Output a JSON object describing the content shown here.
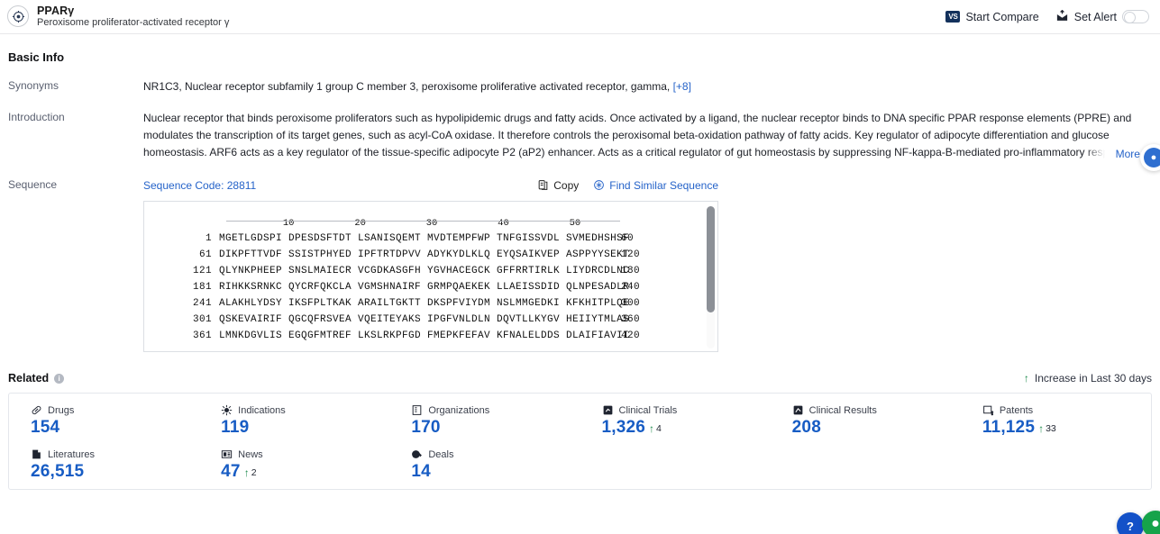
{
  "header": {
    "title": "PPARγ",
    "subtitle": "Peroxisome proliferator-activated receptor γ",
    "logo_icon": "target-crosshair-icon",
    "compare": {
      "badge": "VS",
      "label": "Start Compare"
    },
    "alert": {
      "icon": "alert-bell-icon",
      "label": "Set Alert",
      "toggle_on": false
    }
  },
  "basic_info": {
    "section_title": "Basic Info",
    "synonyms": {
      "label": "Synonyms",
      "value": "NR1C3,  Nuclear receptor subfamily 1 group C member 3,  peroxisome proliferative activated receptor, gamma,",
      "more_count": "[+8]"
    },
    "introduction": {
      "label": "Introduction",
      "text": "Nuclear receptor that binds peroxisome proliferators such as hypolipidemic drugs and fatty acids. Once activated by a ligand, the nuclear receptor binds to DNA specific PPAR response elements (PPRE) and modulates the transcription of its target genes, such as acyl-CoA oxidase. It therefore controls the peroxisomal beta-oxidation pathway of fatty acids. Key regulator of adipocyte differentiation and glucose homeostasis. ARF6 acts as a key regulator of the tissue-specific adipocyte P2 (aP2) enhancer. Acts as a critical regulator of gut homeostasis by suppressing NF-kappa-B-mediated pro-inflammatory responses. Plays a role in the regulation of cardiovascular circadian rhythms.",
      "more_label": "More",
      "more_chevron": "chevron-down-icon"
    },
    "sequence": {
      "label": "Sequence",
      "code_label": "Sequence Code: 28811",
      "copy_label": "Copy",
      "copy_icon": "copy-icon",
      "find_similar_label": "Find Similar Sequence",
      "find_similar_icon": "find-similar-icon",
      "ruler_ticks": [
        10,
        20,
        30,
        40,
        50
      ],
      "rows": [
        {
          "start": "1",
          "blocks": [
            "MGETLGDSPI",
            "DPESDSFTDT",
            "LSANISQEMT",
            "MVDTEMPFWP",
            "TNFGISSVDL",
            "SVMEDHSHSF"
          ],
          "end": "60"
        },
        {
          "start": "61",
          "blocks": [
            "DIKPFTTVDF",
            "SSISTPHYED",
            "IPFTRTDPVV",
            "ADYKYDLKLQ",
            "EYQSAIKVEP",
            "ASPPYYSEKT"
          ],
          "end": "120"
        },
        {
          "start": "121",
          "blocks": [
            "QLYNKPHEEP",
            "SNSLMAIECR",
            "VCGDKASGFH",
            "YGVHACEGCK",
            "GFFRRTIRLK",
            "LIYDRCDLNC"
          ],
          "end": "180"
        },
        {
          "start": "181",
          "blocks": [
            "RIHKKSRNKC",
            "QYCRFQKCLA",
            "VGMSHNAIRF",
            "GRMPQAEKEK",
            "LLAEISSDID",
            "QLNPESADLR"
          ],
          "end": "240"
        },
        {
          "start": "241",
          "blocks": [
            "ALAKHLYDSY",
            "IKSFPLTKAK",
            "ARAILTGKTT",
            "DKSPFVIYDM",
            "NSLMMGEDKI",
            "KFKHITPLQE"
          ],
          "end": "300"
        },
        {
          "start": "301",
          "blocks": [
            "QSKEVAIRIF",
            "QGCQFRSVEA",
            "VQEITEYAKS",
            "IPGFVNLDLN",
            "DQVTLLKYGV",
            "HEIIYTMLAS"
          ],
          "end": "360"
        },
        {
          "start": "361",
          "blocks": [
            "LMNKDGVLIS",
            "EGQGFMTREF",
            "LKSLRKPFGD",
            "FMEPKFEFAV",
            "KFNALELDDS",
            "DLAIFIAVII"
          ],
          "end": "420"
        }
      ]
    }
  },
  "related": {
    "title": "Related",
    "info_icon": "info-icon",
    "legend": {
      "arrow_icon": "arrow-up-icon",
      "label": "Increase in Last 30 days"
    },
    "stats": [
      {
        "label": "Drugs",
        "icon": "pill-icon",
        "value": "154",
        "delta": ""
      },
      {
        "label": "Indications",
        "icon": "virus-icon",
        "value": "119",
        "delta": ""
      },
      {
        "label": "Organizations",
        "icon": "building-icon",
        "value": "170",
        "delta": ""
      },
      {
        "label": "Clinical Trials",
        "icon": "clinical-trial-icon",
        "value": "1,326",
        "delta": "4"
      },
      {
        "label": "Clinical Results",
        "icon": "clinical-result-icon",
        "value": "208",
        "delta": ""
      },
      {
        "label": "Patents",
        "icon": "patent-icon",
        "value": "11,125",
        "delta": "33"
      },
      {
        "label": "Literatures",
        "icon": "literature-icon",
        "value": "26,515",
        "delta": ""
      },
      {
        "label": "News",
        "icon": "news-icon",
        "value": "47",
        "delta": "2"
      },
      {
        "label": "Deals",
        "icon": "deals-icon",
        "value": "14",
        "delta": ""
      }
    ]
  },
  "colors": {
    "accent_blue": "#175cc4",
    "link_blue": "#2563c9",
    "increase_green": "#1e8b4d",
    "badge_navy": "#13315c"
  },
  "floating": {
    "side_button_icon": "assistant-icon",
    "bottom_button_1_icon": "help-icon",
    "bottom_button_2_icon": "chat-icon"
  }
}
